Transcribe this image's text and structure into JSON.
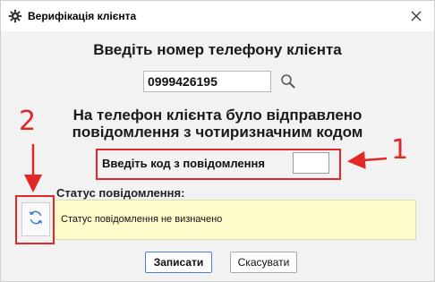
{
  "window": {
    "title": "Верифікація клієнта",
    "app_icon": "gear-icon",
    "close_icon": "close-icon"
  },
  "main": {
    "heading": "Введіть номер телефону клієнта",
    "phone_value": "0999426195",
    "search_icon": "search-icon",
    "sent_message_line1": "На телефон клієнта було відправлено",
    "sent_message_line2": "повідомлення з чотиризначним кодом",
    "code_label": "Введіть код з повідомлення",
    "code_value": ""
  },
  "status": {
    "label": "Статус повідомлення:",
    "text": "Статус повідомлення не визначено",
    "refresh_icon": "refresh-icon",
    "panel_color": "#fffccc"
  },
  "buttons": {
    "save_label": "Записати",
    "cancel_label": "Скасувати"
  },
  "annotations": {
    "marker_1": "1",
    "marker_2": "2",
    "color": "#e32626"
  }
}
